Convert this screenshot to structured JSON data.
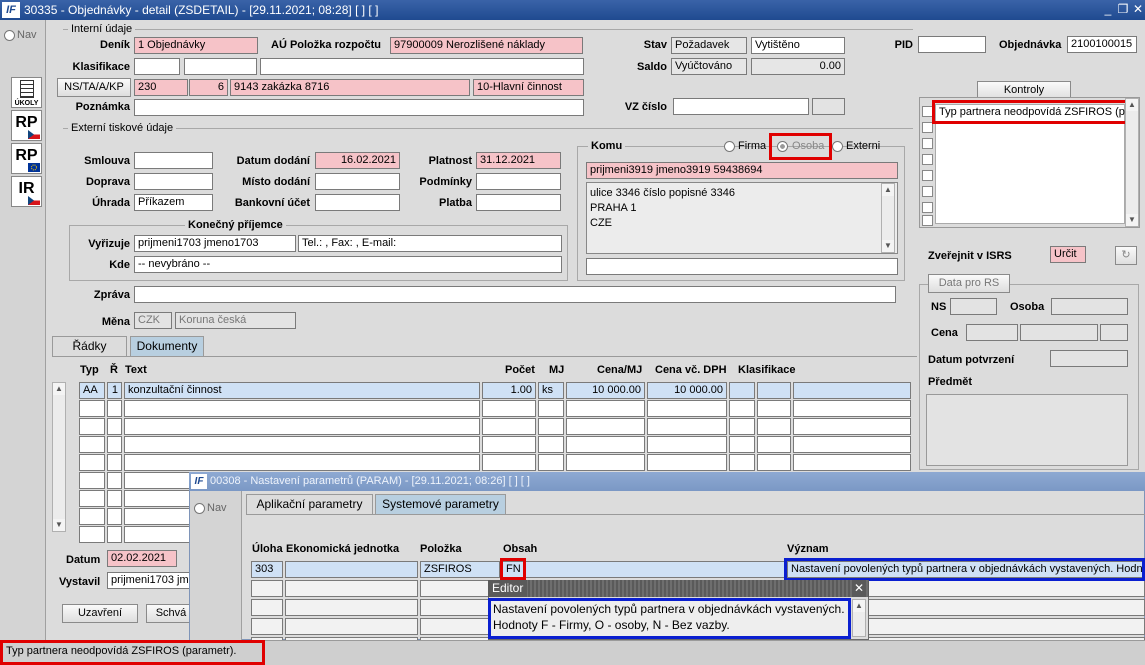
{
  "window": {
    "title": "30335 - Objednávky - detail (ZSDETAIL) - [29.11.2021; 08:28] [ ] [ ]"
  },
  "nav_label": "Nav",
  "side_buttons": [
    {
      "label": "ÚKOLY",
      "icon": "tasks-icon"
    },
    {
      "label": "RP",
      "icon": "flag-cz-icon"
    },
    {
      "label": "RP",
      "icon": "flag-eu-icon"
    },
    {
      "label": "IR",
      "icon": "flag-cz-icon"
    }
  ],
  "internal": {
    "section_label": "Interní údaje",
    "denik_label": "Deník",
    "denik_value": "1 Objednávky",
    "au_label": "AÚ Položka rozpočtu",
    "au_value": "97900009 Nerozlišené náklady",
    "klasifikace_label": "Klasifikace",
    "nstakp_label": "NS/TA/A/KP",
    "ns_value": "230",
    "ta_value": "6",
    "a_value": "9143 zakázka 8716",
    "kp_value": "10-Hlavní činnost",
    "poznamka_label": "Poznámka",
    "stav_label": "Stav",
    "stav_value1": "Požadavek",
    "stav_value2": "Vytištěno",
    "saldo_label": "Saldo",
    "saldo_value1": "Vyúčtováno",
    "saldo_value2": "0.00",
    "vz_label": "VZ číslo",
    "pid_label": "PID",
    "objednavka_label": "Objednávka",
    "objednavka_value": "2100100015"
  },
  "external": {
    "section_label": "Externí tiskové údaje",
    "smlouva_label": "Smlouva",
    "doprava_label": "Doprava",
    "uhrada_label": "Úhrada",
    "uhrada_value": "Příkazem",
    "datum_dodani_label": "Datum dodání",
    "datum_dodani_value": "16.02.2021",
    "misto_dodani_label": "Místo dodání",
    "bankovni_ucet_label": "Bankovní účet",
    "platnost_label": "Platnost",
    "platnost_value": "31.12.2021",
    "podminky_label": "Podmínky",
    "platba_label": "Platba",
    "konecny_label": "Konečný příjemce",
    "vyrizuje_label": "Vyřizuje",
    "vyrizuje_value": "prijmeni1703 jmeno1703",
    "tel_value": "Tel.: , Fax: , E-mail:",
    "kde_label": "Kde",
    "kde_value": "-- nevybráno --",
    "zprava_label": "Zpráva",
    "mena_label": "Měna",
    "mena_code": "CZK",
    "mena_name": "Koruna česká"
  },
  "komu": {
    "label": "Komu",
    "radio_firma": "Firma",
    "radio_osoba": "Osoba",
    "radio_externi": "Externi",
    "name_value": "prijmeni3919 jmeno3919 59438694",
    "address_lines": [
      "ulice 3346 číslo popisné 3346",
      "PRAHA 1",
      "CZE"
    ]
  },
  "kontroly": {
    "button_label": "Kontroly",
    "message": "Typ partnera neodpovídá ZSFIROS (parametr)."
  },
  "zverejnit": {
    "label": "Zveřejnit v ISRS",
    "value": "Určit"
  },
  "rs": {
    "tab_label": "Data pro RS",
    "ns_label": "NS",
    "osoba_label": "Osoba",
    "cena_label": "Cena",
    "datum_label": "Datum potvrzení",
    "predmet_label": "Předmět"
  },
  "tabs": {
    "radky": "Řádky",
    "dokumenty": "Dokumenty"
  },
  "grid": {
    "headers": {
      "typ": "Typ",
      "r": "Ř",
      "text": "Text",
      "pocet": "Počet",
      "mj": "MJ",
      "cena_mj": "Cena/MJ",
      "cena_dph": "Cena vč. DPH",
      "klasifikace": "Klasifikace"
    },
    "row": {
      "typ": "AA",
      "r": "1",
      "text": "konzultační činnost",
      "pocet": "1.00",
      "mj": "ks",
      "cena_mj": "10 000.00",
      "cena_dph": "10 000.00"
    }
  },
  "footer": {
    "datum_label": "Datum",
    "datum_value": "02.02.2021",
    "vystavil_label": "Vystavil",
    "vystavil_value": "prijmeni1703 jmeno1703",
    "uzavreni_label": "Uzavření",
    "schvaleni_label": "Schvá"
  },
  "param_window": {
    "title": "00308 - Nastavení parametrů (PARAM) - [29.11.2021; 08:26] [ ] [ ]",
    "nav_label": "Nav",
    "tab_aplikacni": "Aplikační parametry",
    "tab_systemove": "Systemové parametry",
    "headers": {
      "uloha": "Úloha",
      "ekonomicka": "Ekonomická jednotka",
      "polozka": "Položka",
      "obsah": "Obsah",
      "vyznam": "Význam"
    },
    "row": {
      "uloha": "303",
      "polozka": "ZSFIROS",
      "obsah": "FN",
      "vyznam": "Nastavení povolených typů partnera v objednávkách vystavených. Hodn"
    }
  },
  "editor": {
    "title": "Editor",
    "line1": "Nastavení povolených typů partnera v objednávkách vystavených.",
    "line2": "Hodnoty F - Firmy, O - osoby, N - Bez vazby."
  },
  "status": {
    "message": "Typ partnera neodpovídá ZSFIROS (parametr)."
  }
}
